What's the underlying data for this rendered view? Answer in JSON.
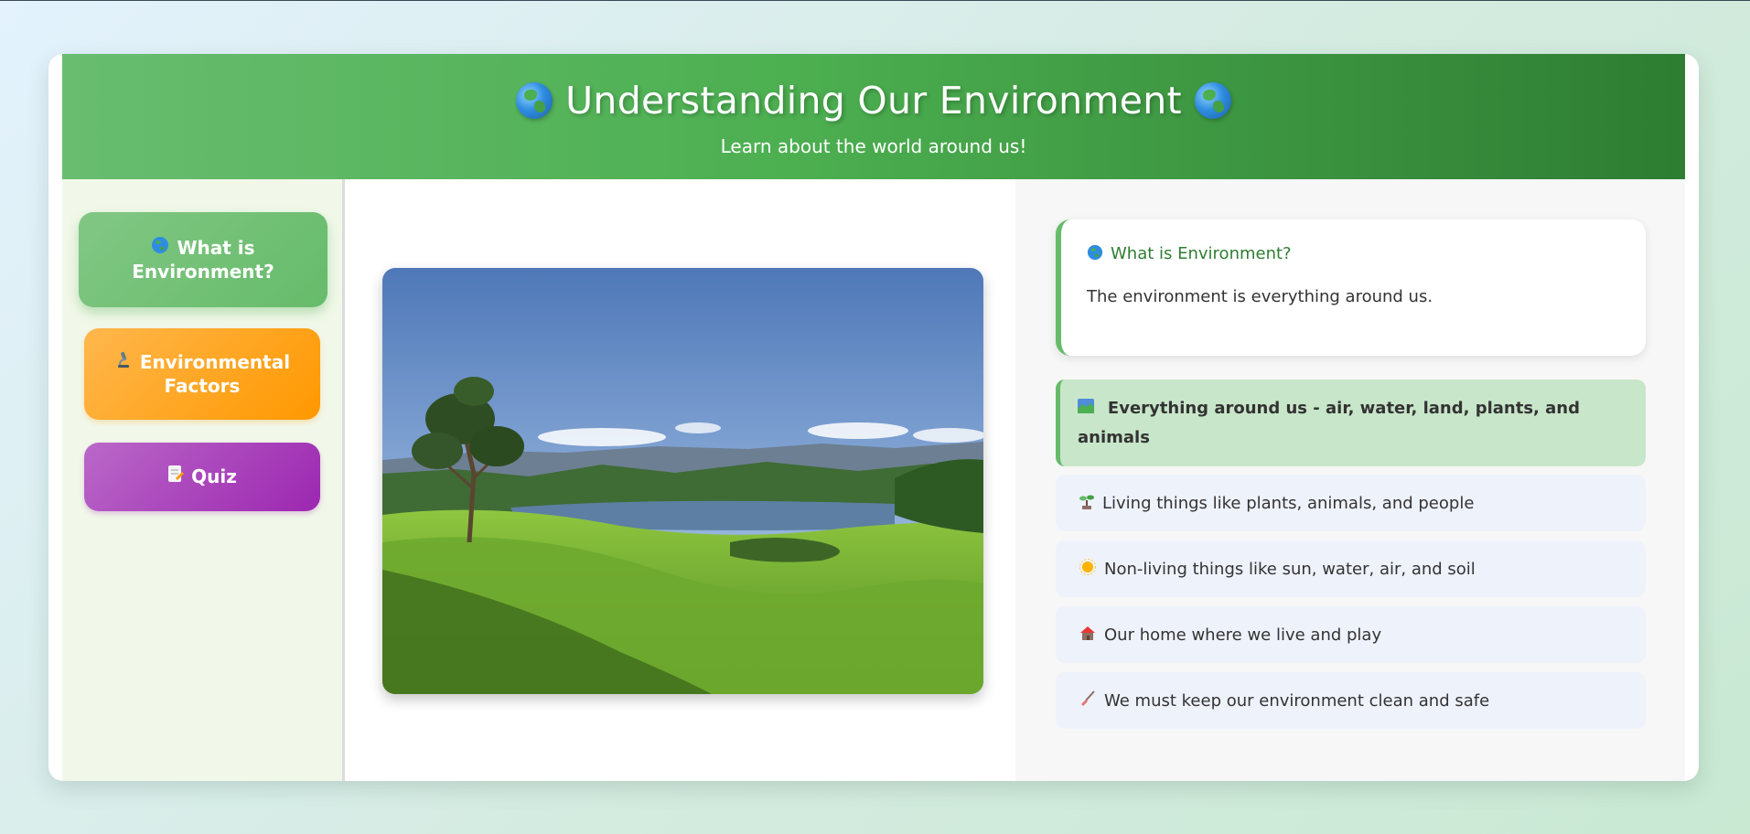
{
  "header": {
    "title": "Understanding Our Environment",
    "subtitle": "Learn about the world around us!"
  },
  "nav": {
    "items": [
      {
        "label": "What is Environment?",
        "icon": "globe-icon",
        "color": "#66bb6a",
        "active": true
      },
      {
        "label": "Environmental Factors",
        "icon": "microscope-icon",
        "color": "#ff9800",
        "active": false
      },
      {
        "label": "Quiz",
        "icon": "memo-icon",
        "color": "#9c27b0",
        "active": false
      }
    ]
  },
  "image": {
    "description": "landscape-photo"
  },
  "info": {
    "icon": "globe-icon",
    "title": "What is Environment?",
    "body": "The environment is everything around us."
  },
  "facts": [
    {
      "icon": "landscape-icon",
      "text": "Everything around us - air, water, land, plants, and animals",
      "highlighted": true
    },
    {
      "icon": "seedling-icon",
      "text": "Living things like plants, animals, and people",
      "highlighted": false
    },
    {
      "icon": "sun-icon",
      "text": "Non-living things like sun, water, air, and soil",
      "highlighted": false
    },
    {
      "icon": "house-icon",
      "text": "Our home where we live and play",
      "highlighted": false
    },
    {
      "icon": "broom-icon",
      "text": "We must keep our environment clean and safe",
      "highlighted": false
    }
  ],
  "colors": {
    "header_start": "#68bd6f",
    "header_end": "#2e7d32",
    "accent": "#66bb6a"
  }
}
